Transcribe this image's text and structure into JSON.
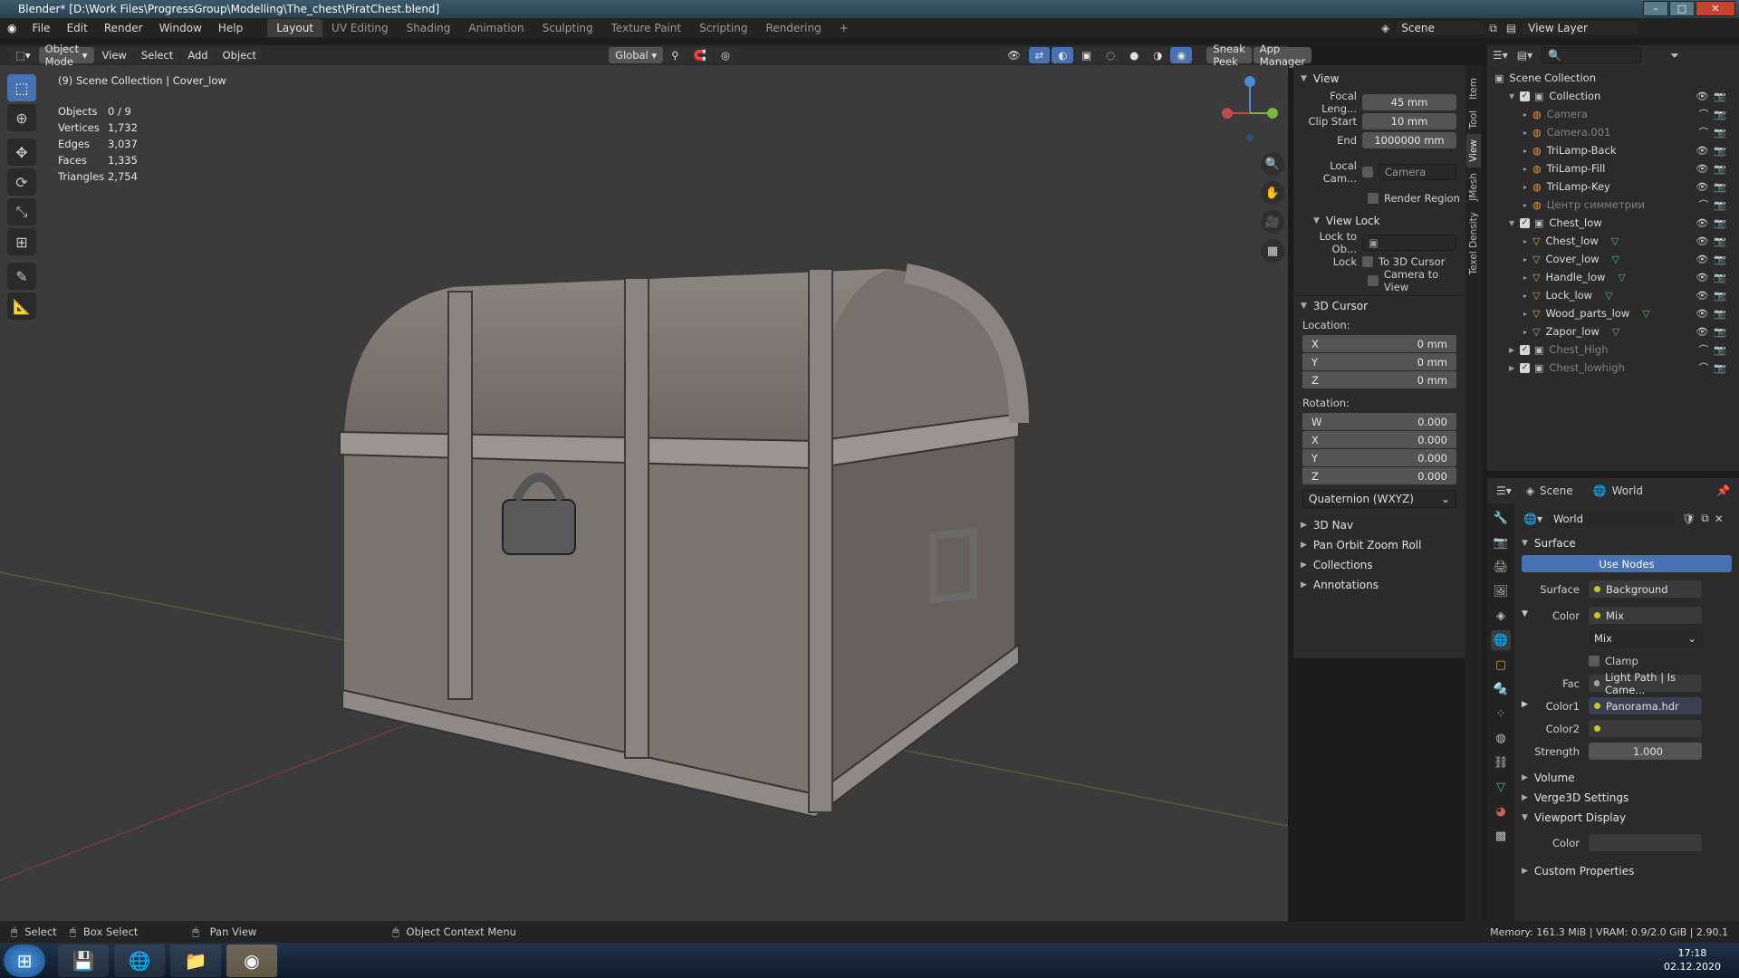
{
  "window": {
    "title": "Blender* [D:\\Work Files\\ProgressGroup\\Modelling\\The_chest\\PiratChest.blend]"
  },
  "menu": [
    "File",
    "Edit",
    "Render",
    "Window",
    "Help"
  ],
  "workspaces": [
    "Layout",
    "UV Editing",
    "Shading",
    "Animation",
    "Sculpting",
    "Texture Paint",
    "Scripting",
    "Rendering"
  ],
  "scene": {
    "name": "Scene",
    "view_layer": "View Layer"
  },
  "viewport_header": {
    "mode": "Object Mode",
    "menus": [
      "View",
      "Select",
      "Add",
      "Object"
    ],
    "transform": "Global",
    "addons": [
      "Sneak Peek",
      "App Manager"
    ]
  },
  "viewport": {
    "title": "(9) Scene Collection | Cover_low",
    "stats": [
      {
        "k": "Objects",
        "v": "0 / 9"
      },
      {
        "k": "Vertices",
        "v": "1,732"
      },
      {
        "k": "Edges",
        "v": "3,037"
      },
      {
        "k": "Faces",
        "v": "1,335"
      },
      {
        "k": "Triangles",
        "v": "2,754"
      }
    ]
  },
  "npanel": {
    "view_header": "View",
    "focal_label": "Focal Leng...",
    "focal": "45 mm",
    "clip_start_label": "Clip Start",
    "clip_start": "10 mm",
    "end_label": "End",
    "end": "1000000 mm",
    "local_cam_label": "Local Cam...",
    "local_cam_value": "Camera",
    "render_region": "Render Region",
    "view_lock": "View Lock",
    "lock_to_ob": "Lock to Ob...",
    "lock": "Lock",
    "to_3d_cursor": "To 3D Cursor",
    "camera_to_view": "Camera to View",
    "cursor_header": "3D Cursor",
    "location_label": "Location:",
    "location": [
      {
        "a": "X",
        "v": "0 mm"
      },
      {
        "a": "Y",
        "v": "0 mm"
      },
      {
        "a": "Z",
        "v": "0 mm"
      }
    ],
    "rotation_label": "Rotation:",
    "rotation": [
      {
        "a": "W",
        "v": "0.000"
      },
      {
        "a": "X",
        "v": "0.000"
      },
      {
        "a": "Y",
        "v": "0.000"
      },
      {
        "a": "Z",
        "v": "0.000"
      }
    ],
    "rotation_mode": "Quaternion (WXYZ)",
    "collapsed": [
      "3D Nav",
      "Pan Orbit Zoom Roll",
      "Collections",
      "Annotations"
    ]
  },
  "side_tabs": [
    "Item",
    "Tool",
    "View",
    "JMesh",
    "Texel Density"
  ],
  "outliner": {
    "root": "Scene Collection",
    "rows": [
      {
        "name": "Collection",
        "type": "collection",
        "indent": 1,
        "dim": false
      },
      {
        "name": "Camera",
        "type": "object",
        "indent": 2,
        "dim": true
      },
      {
        "name": "Camera.001",
        "type": "object",
        "indent": 2,
        "dim": true
      },
      {
        "name": "TriLamp-Back",
        "type": "object",
        "indent": 2,
        "dim": false
      },
      {
        "name": "TriLamp-Fill",
        "type": "object",
        "indent": 2,
        "dim": false
      },
      {
        "name": "TriLamp-Key",
        "type": "object",
        "indent": 2,
        "dim": false
      },
      {
        "name": "Центр симметрии",
        "type": "object",
        "indent": 2,
        "dim": true
      },
      {
        "name": "Chest_low",
        "type": "collection",
        "indent": 1,
        "dim": false
      },
      {
        "name": "Chest_low",
        "type": "mesh",
        "indent": 2,
        "dim": false
      },
      {
        "name": "Cover_low",
        "type": "mesh",
        "indent": 2,
        "dim": false
      },
      {
        "name": "Handle_low",
        "type": "mesh",
        "indent": 2,
        "dim": false
      },
      {
        "name": "Lock_low",
        "type": "mesh",
        "indent": 2,
        "dim": false
      },
      {
        "name": "Wood_parts_low",
        "type": "mesh",
        "indent": 2,
        "dim": false
      },
      {
        "name": "Zapor_low",
        "type": "mesh",
        "indent": 2,
        "dim": false
      },
      {
        "name": "Chest_High",
        "type": "collection",
        "indent": 1,
        "dim": true
      },
      {
        "name": "Chest_lowhigh",
        "type": "collection",
        "indent": 1,
        "dim": true
      }
    ]
  },
  "properties": {
    "breadcrumb_scene": "Scene",
    "breadcrumb_world": "World",
    "world_name": "World",
    "surface_header": "Surface",
    "use_nodes": "Use Nodes",
    "surface_label": "Surface",
    "surface_value": "Background",
    "color_label": "Color",
    "color_value": "Mix",
    "mix_mode": "Mix",
    "clamp": "Clamp",
    "fac_label": "Fac",
    "fac_value": "Light Path | Is Came...",
    "color1_label": "Color1",
    "color1_value": "Panorama.hdr",
    "color2_label": "Color2",
    "strength_label": "Strength",
    "strength_value": "1.000",
    "collapsed": [
      "Volume",
      "Verge3D Settings"
    ],
    "viewport_display": "Viewport Display",
    "vd_color_label": "Color",
    "custom_props": "Custom Properties"
  },
  "statusbar": {
    "select": "Select",
    "box_select": "Box Select",
    "pan": "Pan View",
    "context": "Object Context Menu",
    "memory": "Memory: 161.3 MiB | VRAM: 0.9/2.0 GiB | 2.90.1"
  },
  "clock": {
    "time": "17:18",
    "date": "02.12.2020"
  }
}
